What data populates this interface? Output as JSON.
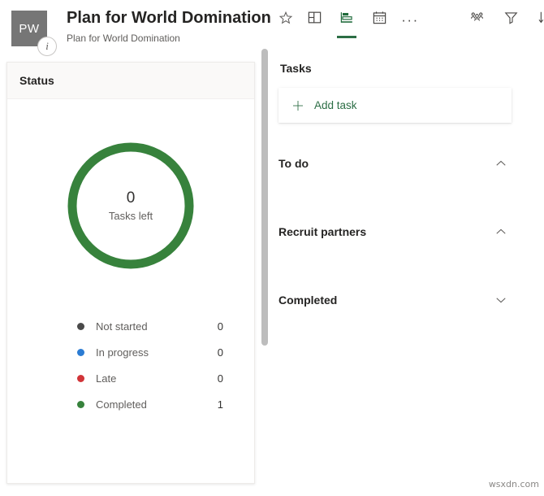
{
  "header": {
    "avatar_initials": "PW",
    "info_badge_icon": "info-icon",
    "plan_title": "Plan for World Domination",
    "plan_subtitle": "Plan for World Domination",
    "favorite_icon": "star-outline-icon"
  },
  "toolbar": {
    "left_items": [
      {
        "icon": "board-view-icon",
        "label": "Board",
        "selected": false
      },
      {
        "icon": "charts-view-icon",
        "label": "Charts",
        "selected": true
      },
      {
        "icon": "schedule-calendar-icon",
        "label": "Schedule",
        "selected": false
      }
    ],
    "more_label": "···",
    "right_items": [
      {
        "icon": "group-by-people-icon",
        "label": "Group by"
      },
      {
        "icon": "filter-funnel-icon",
        "label": "Filter"
      },
      {
        "icon": "sort-descending-icon",
        "label": "Sort"
      }
    ],
    "selected_accent": "#2c6e45"
  },
  "status_card": {
    "title": "Status",
    "donut": {
      "center_value": "0",
      "center_label": "Tasks left"
    }
  },
  "chart_data": {
    "type": "pie",
    "title": "Status",
    "categories": [
      "Not started",
      "In progress",
      "Late",
      "Completed"
    ],
    "values": [
      0,
      0,
      0,
      1
    ],
    "colors": [
      "#4a4a4a",
      "#2b7cd3",
      "#d13438",
      "#37823c"
    ],
    "center_value": 0,
    "center_label": "Tasks left",
    "legend_position": "bottom",
    "total": 1
  },
  "tasks": {
    "heading": "Tasks",
    "add_task": {
      "icon": "plus-icon",
      "label": "Add task"
    },
    "buckets": [
      {
        "name": "To do",
        "chevron": "chevron-up-icon",
        "expanded": true
      },
      {
        "name": "Recruit partners",
        "chevron": "chevron-up-icon",
        "expanded": true
      },
      {
        "name": "Completed",
        "chevron": "chevron-down-icon",
        "expanded": false
      }
    ]
  },
  "scrollbar": {
    "name": "vertical-scrollbar"
  },
  "watermark": "wsxdn.com"
}
